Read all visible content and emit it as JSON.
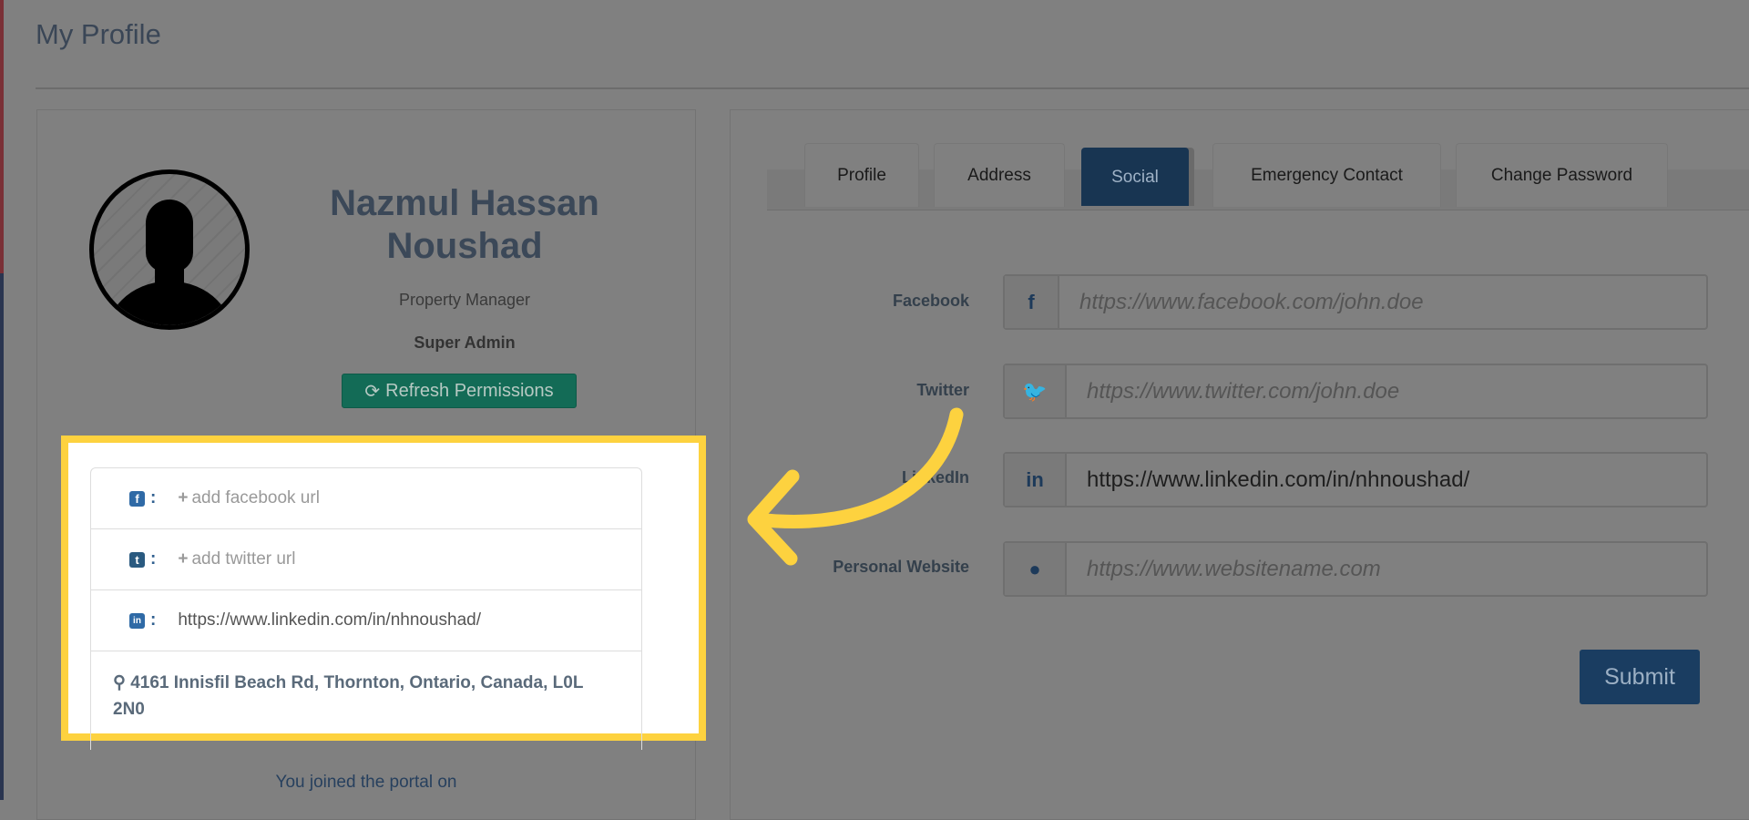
{
  "page": {
    "title": "My Profile"
  },
  "profile": {
    "name_line1": "Nazmul Hassan",
    "name_line2": "Noushad",
    "role": "Property Manager",
    "permission": "Super Admin",
    "refresh_label": "Refresh Permissions",
    "joined_text": "You joined the portal on"
  },
  "social_list": {
    "facebook": {
      "icon": "f",
      "value": "add facebook url"
    },
    "twitter": {
      "icon": "t",
      "value": "add twitter url"
    },
    "linkedin": {
      "icon": "in",
      "value": "https://www.linkedin.com/in/nhnoushad/"
    },
    "address": "4161 Innisfil Beach Rd, Thornton, Ontario, Canada, L0L 2N0"
  },
  "tabs": [
    {
      "label": "Profile"
    },
    {
      "label": "Address"
    },
    {
      "label": "Social",
      "active": true
    },
    {
      "label": "Emergency Contact"
    },
    {
      "label": "Change Password"
    }
  ],
  "form": {
    "facebook": {
      "label": "Facebook",
      "icon": "f",
      "placeholder": "https://www.facebook.com/john.doe",
      "value": ""
    },
    "twitter": {
      "label": "Twitter",
      "icon": "twitter-bird",
      "placeholder": "https://www.twitter.com/john.doe",
      "value": ""
    },
    "linkedin": {
      "label": "LinkedIn",
      "icon": "in",
      "placeholder": "",
      "value": "https://www.linkedin.com/in/nhnoushad/"
    },
    "website": {
      "label": "Personal Website",
      "icon": "globe",
      "placeholder": "https://www.websitename.com",
      "value": ""
    },
    "submit_label": "Submit"
  },
  "colors": {
    "highlight": "#fdd23f",
    "active_tab": "#183552",
    "refresh_button": "#136b56"
  }
}
